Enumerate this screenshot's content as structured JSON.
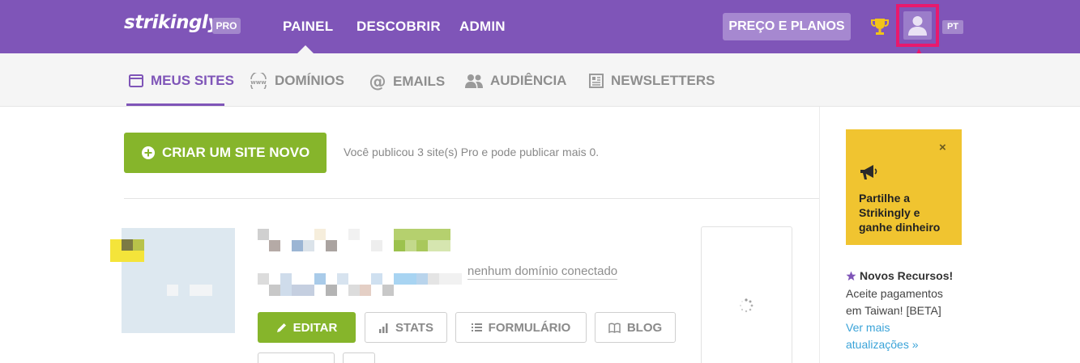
{
  "brand": {
    "logo": "strikingly",
    "badge": "PRO"
  },
  "topnav": {
    "items": [
      {
        "label": "PAINEL",
        "active": true
      },
      {
        "label": "DESCOBRIR",
        "active": false
      },
      {
        "label": "ADMIN",
        "active": false
      }
    ],
    "pricing_label": "PREÇO E PLANOS",
    "language": "PT",
    "trophy_icon": "trophy-icon",
    "user_icon": "user-icon"
  },
  "subnav": {
    "items": [
      {
        "label": "MEUS SITES",
        "icon": "browser-window-icon",
        "active": true
      },
      {
        "label": "DOMÍNIOS",
        "icon": "www-icon",
        "active": false
      },
      {
        "label": "EMAILS",
        "icon": "at-icon",
        "active": false
      },
      {
        "label": "AUDIÊNCIA",
        "icon": "people-icon",
        "active": false
      },
      {
        "label": "NEWSLETTERS",
        "icon": "newsletter-icon",
        "active": false
      }
    ]
  },
  "main": {
    "create_button": "CRIAR UM SITE NOVO",
    "publish_info": "Você publicou 3 site(s) Pro e pode publicar mais 0.",
    "site": {
      "domain_status": "nenhum domínio conectado",
      "actions": {
        "edit": "EDITAR",
        "stats": "STATS",
        "form": "FORMULÁRIO",
        "blog": "BLOG"
      }
    }
  },
  "sidebar": {
    "promo": {
      "close": "×",
      "text": "Partilhe a Strikingly e ganhe dinheiro"
    },
    "news": {
      "title": "Novos Recursos!",
      "body": "Aceite pagamentos em Taiwan! [BETA]",
      "link": "Ver mais atualizações »"
    }
  },
  "colors": {
    "brand_purple": "#7f55b8",
    "accent_green": "#86b52b",
    "promo_yellow": "#f0c430",
    "highlight_pink": "#e8196d",
    "link_blue": "#3aa3d8"
  }
}
